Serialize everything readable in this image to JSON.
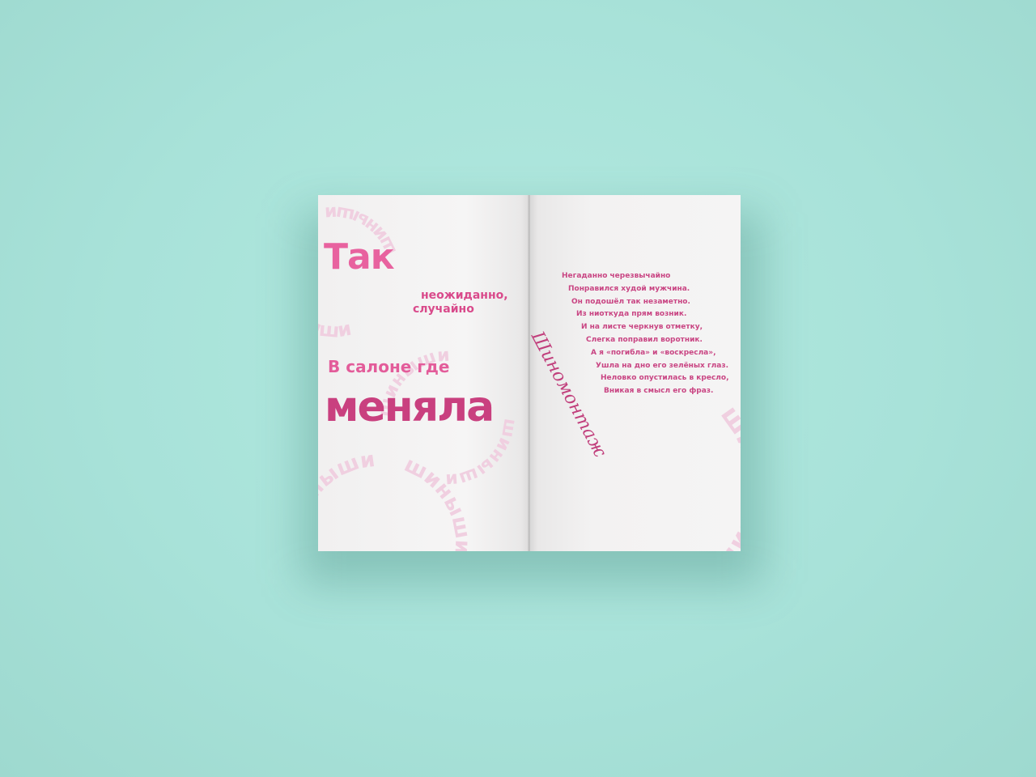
{
  "scene": {
    "background_color": "#a8e2d9",
    "paper_color": "#f4f3f3",
    "accent_colors": {
      "primary_pink": "#e8629f",
      "deep_pink": "#c9407f",
      "ring_pink": "#f0cfe0"
    }
  },
  "left_page": {
    "title": "Так",
    "subtitle_line1": "неожиданно,",
    "subtitle_line2": "случайно",
    "line_salon": "В салоне где",
    "line_menyala": "меняла",
    "ring_word": "шиныши"
  },
  "right_page": {
    "script_word": "Шиномонтаж",
    "ring_word": "шины шины",
    "poem": [
      "Негаданно черезвычайно",
      "Понравился худой мужчина.",
      "Он подошёл так незаметно.",
      "Из ниоткуда прям возник.",
      "И на листе черкнув отметку,",
      "Слегка поправил воротник.",
      "А я «погибла» и «воскресла»,",
      "Ушла на дно его зелёных глаз.",
      "Неловко опустилась в кресло,",
      "Вникая в смысл его фраз."
    ]
  }
}
